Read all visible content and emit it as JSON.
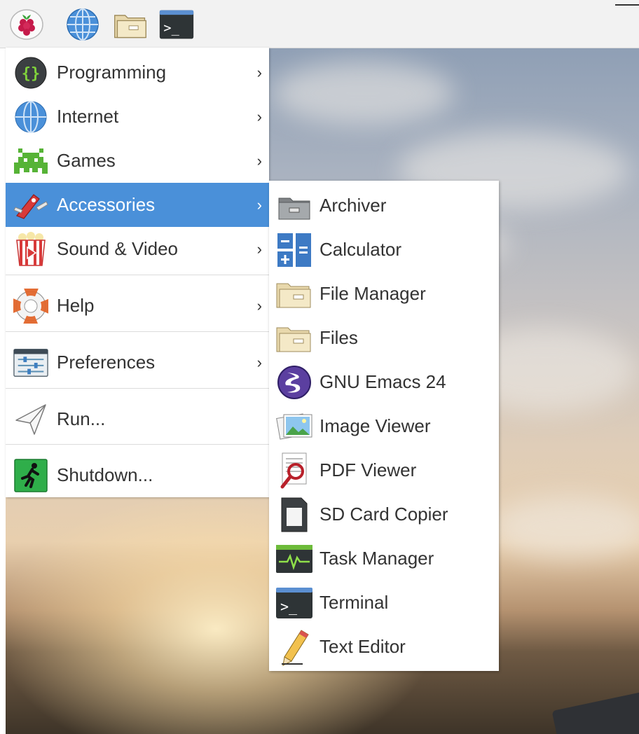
{
  "taskbar": {
    "launchers": [
      {
        "icon": "raspberry-pi-menu-icon"
      },
      {
        "icon": "web-browser-globe-icon"
      },
      {
        "icon": "file-manager-folder-icon"
      },
      {
        "icon": "terminal-icon",
        "glyph": ">_"
      }
    ]
  },
  "menu": {
    "items": [
      {
        "label": "Programming",
        "icon": "programming-braces-icon",
        "arrow": "›"
      },
      {
        "label": "Internet",
        "icon": "internet-globe-icon",
        "arrow": "›"
      },
      {
        "label": "Games",
        "icon": "games-invader-icon",
        "arrow": "›"
      },
      {
        "label": "Accessories",
        "icon": "accessories-knife-icon",
        "arrow": "›",
        "active": true
      },
      {
        "label": "Sound & Video",
        "icon": "sound-video-popcorn-icon",
        "arrow": "›"
      },
      {
        "label": "Help",
        "icon": "help-lifebuoy-icon",
        "arrow": "›"
      },
      {
        "label": "Preferences",
        "icon": "preferences-sliders-icon",
        "arrow": "›"
      },
      {
        "label": "Run...",
        "icon": "run-paper-plane-icon"
      },
      {
        "label": "Shutdown...",
        "icon": "shutdown-exit-icon"
      }
    ]
  },
  "submenu": {
    "items": [
      {
        "label": "Archiver",
        "icon": "archiver-icon"
      },
      {
        "label": "Calculator",
        "icon": "calculator-icon"
      },
      {
        "label": "File Manager",
        "icon": "file-manager-icon"
      },
      {
        "label": "Files",
        "icon": "files-icon"
      },
      {
        "label": "GNU Emacs 24",
        "icon": "emacs-icon"
      },
      {
        "label": "Image Viewer",
        "icon": "image-viewer-icon"
      },
      {
        "label": "PDF Viewer",
        "icon": "pdf-viewer-icon"
      },
      {
        "label": "SD Card Copier",
        "icon": "sd-card-icon"
      },
      {
        "label": "Task Manager",
        "icon": "task-manager-icon"
      },
      {
        "label": "Terminal",
        "icon": "terminal-icon",
        "glyph": ">_"
      },
      {
        "label": "Text Editor",
        "icon": "text-editor-pencil-icon"
      }
    ]
  },
  "colors": {
    "menu_highlight": "#4a90d9",
    "menu_text": "#333333",
    "panel_bg": "#f2f2f2"
  }
}
